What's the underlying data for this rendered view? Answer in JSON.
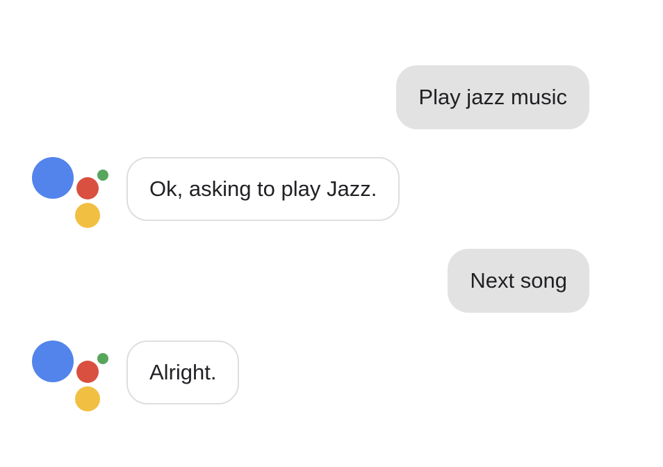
{
  "colors": {
    "blue": "#5384ec",
    "red": "#d95040",
    "yellow": "#f1bf42",
    "green": "#58a55c",
    "user_bubble": "#e2e2e2",
    "assistant_border": "#dedede"
  },
  "conversation": {
    "messages": [
      {
        "role": "user",
        "text": "Play jazz music"
      },
      {
        "role": "assistant",
        "text": "Ok, asking to play Jazz.",
        "icon": "google-assistant-logo-icon"
      },
      {
        "role": "user",
        "text": "Next song"
      },
      {
        "role": "assistant",
        "text": "Alright.",
        "icon": "google-assistant-logo-icon"
      }
    ]
  }
}
